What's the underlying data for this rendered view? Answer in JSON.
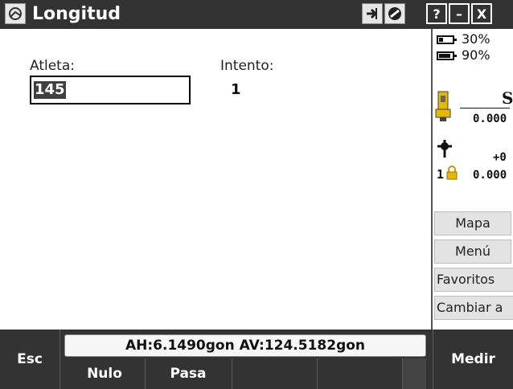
{
  "window": {
    "title": "Longitud"
  },
  "titlebar": {
    "icons": [
      "app-menu-icon",
      "transfer-icon",
      "no-entry-icon",
      "help-icon",
      "minimize-icon",
      "close-icon"
    ],
    "help_label": "?",
    "minimize_label": "–",
    "close_label": "X"
  },
  "form": {
    "athlete_label": "Atleta:",
    "athlete_value": "145",
    "attempt_label": "Intento:",
    "attempt_value": "1"
  },
  "status_panel": {
    "battery1_pct": "30%",
    "battery1_level": 0.3,
    "battery2_pct": "90%",
    "battery2_level": 0.9,
    "instrument_label": "S",
    "instrument_value": "0.000",
    "target_offset": "+0",
    "target_number": "1",
    "target_value": "0.000",
    "buttons": [
      "Mapa",
      "Menú",
      "Favoritos",
      "Cambiar a"
    ]
  },
  "bottom": {
    "esc_label": "Esc",
    "angles_text": "AH:6.1490gon  AV:124.5182gon",
    "soft_keys": [
      "Nulo",
      "Pasa",
      "",
      "",
      ""
    ],
    "measure_label": "Medir"
  },
  "colors": {
    "bar_bg": "#333333",
    "panel_btn_bg": "#e3e3e3",
    "selection_bg": "#404040"
  }
}
